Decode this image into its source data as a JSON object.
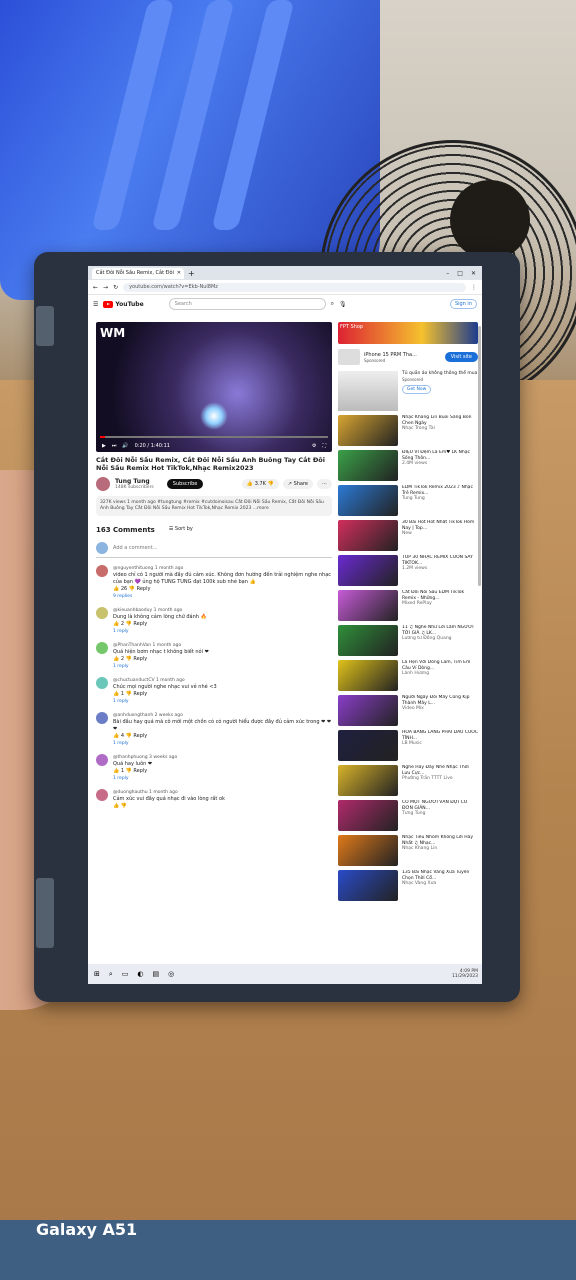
{
  "photo": {
    "watermark": "Galaxy A51"
  },
  "browser": {
    "tab_title": "Cắt Đôi Nỗi Sầu Remix, Cắt Đôi",
    "url": "youtube.com/watch?v=Ekb-Nul8Mz",
    "window_controls": [
      "–",
      "□",
      "✕"
    ]
  },
  "youtube": {
    "logo": "YouTube",
    "search_placeholder": "Search",
    "signin": "Sign in",
    "player": {
      "time": "0:20 / 1:40:11",
      "progress": 0.02,
      "overlay_logo": "WM"
    },
    "video_title": "Cắt Đôi Nỗi Sầu Remix, Cắt Đôi Nỗi Sầu Anh Buông Tay Cắt Đôi Nỗi Sầu Remix Hot TikTok,Nhạc Remix2023",
    "channel_name": "Tung Tung",
    "subscribers": "148K subscribers",
    "subscribe": "Subscribe",
    "likes": "3.7K",
    "share": "Share",
    "description": "327K views  1 month ago  #tungtung #remix #cutdoinoisau  Cắt Đôi Nỗi Sầu Remix, Cắt Đôi Nỗi Sầu Anh Buông Tay Cắt Đôi Nỗi Sầu Remix Hot TikTok,Nhạc Remix 2023 ...more",
    "comments_count": "163 Comments",
    "sort_by": "Sort by",
    "add_comment": "Add a comment...",
    "comments": [
      {
        "author": "@nguyenthituong  1 month ago",
        "text": "video chỉ có 1 người mà đầy đủ cảm xúc. Không đơn hướng đến trải nghiệm nghe nhạc của bạn 💜 ủng hộ TUNG TUNG đạt 100k sub nhé bạn 👍",
        "likes": "26",
        "reply": "Reply",
        "replies": "9 replies"
      },
      {
        "author": "@kieuanhbaoduy  1 month ago",
        "text": "Dung là không cảm lòng chứ đánh 🔥",
        "likes": "2",
        "reply": "Reply",
        "replies": "1 reply"
      },
      {
        "author": "@PhanThanhVan  1 month ago",
        "text": "Quá hiện bơm nhạc t không biết nói ❤",
        "likes": "2",
        "reply": "Reply",
        "replies": "1 reply"
      },
      {
        "author": "@chuctuanductCV  1 month ago",
        "text": "Chúc mọi người nghe nhạc vui vẻ nhé <3",
        "likes": "1",
        "reply": "Reply",
        "replies": "1 reply"
      },
      {
        "author": "@anhduongthanh  2 weeks ago",
        "text": "Bài đầu hay quá mà cô mới một chồn có có người hiểu được đầy đủ cảm xúc trong ❤ ❤ ❤",
        "likes": "4",
        "reply": "Reply",
        "replies": "1 reply"
      },
      {
        "author": "@thanhphuong  3 weeks ago",
        "text": "Quá hay luôn ❤",
        "likes": "1",
        "reply": "Reply",
        "replies": "1 reply"
      },
      {
        "author": "@duonghauthu  1 month ago",
        "text": "Cảm xúc vui đây quá nhạc đi vào lòng rất ok",
        "likes": "",
        "reply": "",
        "replies": ""
      }
    ]
  },
  "sidebar": {
    "ad_banner": "FPT Shop",
    "ad_title": "iPhone 15 PRM Tha...",
    "ad_sponsor": "Sponsored",
    "visit_site": "Visit site",
    "printer_ad": "Tủ quần áo không thông thể mua",
    "printer_ad_meta": "Sponsored",
    "get_now": "Get Now",
    "videos": [
      {
        "title": "Nhạc Khang Lin Buồi Sáng Bon Chen Ngày",
        "meta": "Nhạc Trong Tài",
        "color": "#d8a531"
      },
      {
        "title": "ĐIỆU VI Đệm Lá Em♥ LK Nhạc Sống Thôn...",
        "meta": "2.4M views",
        "color": "#3aa048"
      },
      {
        "title": "EDM TikTok Remix 2023 ♪ Nhạc Trẻ Remix...",
        "meta": "Tung Tung",
        "color": "#2c7ad6"
      },
      {
        "title": "30 Bài Hot Hot Nhất TikTok Hôm Nay | Top...",
        "meta": "New",
        "color": "#d22f5d"
      },
      {
        "title": "TOP 30 NHẠC REMIX CUỐN SAY TIKTOK...",
        "meta": "1.2M views",
        "color": "#6a2ad1"
      },
      {
        "title": "Cắt Đôi Nỗi Sầu EDM TikTok Remix - Những...",
        "meta": "Mixed RePlay",
        "color": "#c75bd8"
      },
      {
        "title": "11 ♫ Nghe Như Lời Lắm NGƯỜI TỚI GIÀ ♫ LK...",
        "meta": "Lương tư Đông Quang",
        "color": "#2f8f3a"
      },
      {
        "title": "Lá Hẹn Với Dòng Lam, Tim Em Câu Ví Dòng...",
        "meta": "Lành Hương",
        "color": "#e0c21a"
      },
      {
        "title": "Người Ngày Đôi Mây Cũng Kịp Thành Mây L...",
        "meta": "Video Mix",
        "color": "#8a3ec9"
      },
      {
        "title": "HOA BẰNG LĂNG PHÁI DẦU CUỐC TÌNH...",
        "meta": "LB Music",
        "color": "#1f1f40"
      },
      {
        "title": "Nghe Hay Đây Nhé Nhạc Thời Lưu Cực...",
        "meta": "Phường Trần TTTT Live",
        "color": "#d8b32a"
      },
      {
        "title": "CÓ MỘT NGƯỜI VẪN ĐỢI CÓ ĐƠN GIẢN...",
        "meta": "Tưng Tùng",
        "color": "#b02a6b"
      },
      {
        "title": "Nhạc Tiểu Nhóm Không Lời Hay Nhất ♫ Nhạc...",
        "meta": "Nhạc Khang Lin",
        "color": "#e07a1a"
      },
      {
        "title": "135 Bài Nhạc Vàng Xưa Tuyển Chọn Thời Cổ...",
        "meta": "Nhạc Vàng Xưa",
        "color": "#2a4bc9"
      }
    ]
  },
  "taskbar": {
    "time": "4:09 PM",
    "date": "11/29/2023",
    "start": "⊞",
    "search": "⌕"
  }
}
